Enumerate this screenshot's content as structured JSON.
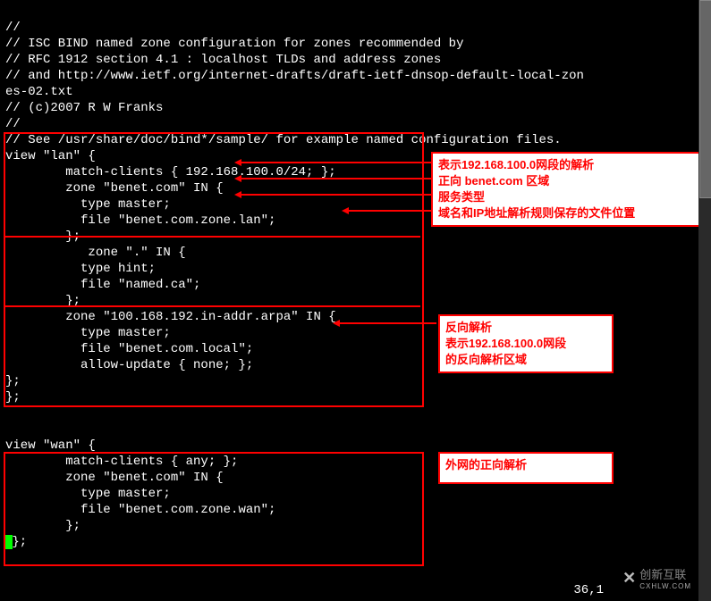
{
  "code": {
    "l1": "//",
    "l2": "// ISC BIND named zone configuration for zones recommended by",
    "l3": "// RFC 1912 section 4.1 : localhost TLDs and address zones",
    "l4": "// and http://www.ietf.org/internet-drafts/draft-ietf-dnsop-default-local-zon",
    "l5": "es-02.txt",
    "l6": "// (c)2007 R W Franks",
    "l7": "//",
    "l8": "// See /usr/share/doc/bind*/sample/ for example named configuration files.",
    "l9": "view \"lan\" {",
    "l10": "        match-clients { 192.168.100.0/24; };",
    "l11": "        zone \"benet.com\" IN {",
    "l12": "          type master;",
    "l13": "          file \"benet.com.zone.lan\";",
    "l14": "        };",
    "l15": "           zone \".\" IN {",
    "l16": "          type hint;",
    "l17": "          file \"named.ca\";",
    "l18": "        };",
    "l19": "        zone \"100.168.192.in-addr.arpa\" IN {",
    "l20": "          type master;",
    "l21": "          file \"benet.com.local\";",
    "l22": "          allow-update { none; };",
    "l23": "};",
    "l24": "};",
    "l25": "",
    "l26": "",
    "l27": "view \"wan\" {",
    "l28": "        match-clients { any; };",
    "l29": "        zone \"benet.com\" IN {",
    "l30": "          type master;",
    "l31": "          file \"benet.com.zone.wan\";",
    "l32": "        };",
    "l33": "};"
  },
  "annotations": {
    "box1": {
      "line1": "表示192.168.100.0网段的解析",
      "line2": "正向 benet.com 区域",
      "line3": "服务类型",
      "line4": "域名和IP地址解析规则保存的文件位置"
    },
    "box2": {
      "line1": "反向解析",
      "line2": "表示192.168.100.0网段",
      "line3": "的反向解析区域"
    },
    "box3": {
      "line1": "外网的正向解析"
    }
  },
  "status": "36,1",
  "watermark": {
    "text_cn": "创新互联",
    "text_en": "CXHLW.COM"
  }
}
